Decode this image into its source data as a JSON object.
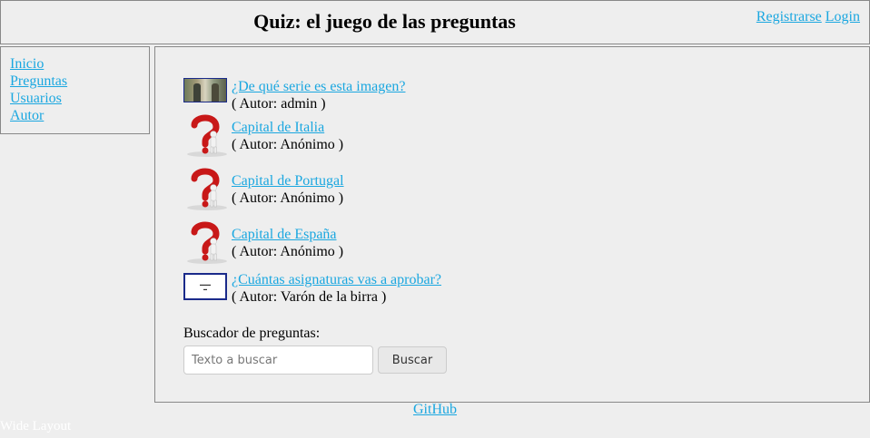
{
  "header": {
    "title": "Quiz: el juego de las preguntas",
    "register_label": "Registrarse",
    "login_label": "Login"
  },
  "sidebar": {
    "items": [
      {
        "label": "Inicio"
      },
      {
        "label": "Preguntas"
      },
      {
        "label": "Usuarios"
      },
      {
        "label": "Autor"
      }
    ]
  },
  "questions": [
    {
      "title": "¿De qué serie es esta imagen?",
      "author": "( Autor: admin )",
      "thumb": "photo-thumbnail"
    },
    {
      "title": "Capital de Italia",
      "author": "( Autor: Anónimo )",
      "thumb": "question-mark-icon"
    },
    {
      "title": "Capital de Portugal",
      "author": "( Autor: Anónimo )",
      "thumb": "question-mark-icon"
    },
    {
      "title": "Capital de España",
      "author": "( Autor: Anónimo )",
      "thumb": "question-mark-icon"
    },
    {
      "title": "¿Cuántas asignaturas vas a aprobar?",
      "author": "( Autor: Varón de la birra )",
      "thumb": "board-thumbnail"
    }
  ],
  "search": {
    "label": "Buscador de preguntas:",
    "placeholder": "Texto a buscar",
    "value": "",
    "button_label": "Buscar"
  },
  "footer": {
    "github_label": "GitHub",
    "wide_layout_label": "Wide Layout"
  },
  "colors": {
    "link": "#1aa7e0",
    "background": "#eeeeee",
    "border": "#888888"
  }
}
